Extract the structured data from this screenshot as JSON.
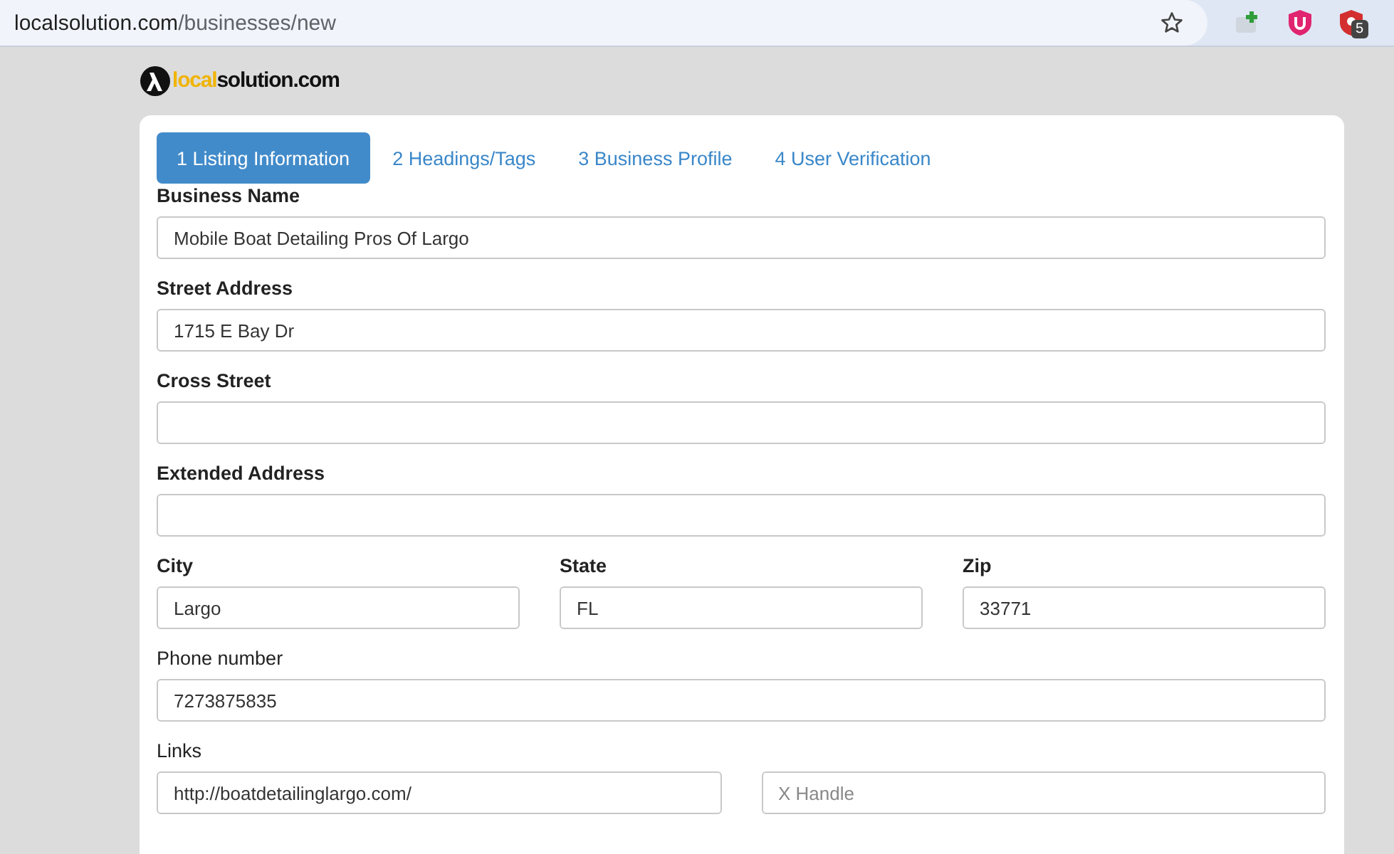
{
  "browser": {
    "url_host": "localsolution.com",
    "url_path": "/businesses/new",
    "extension_badge": "5"
  },
  "logo": {
    "accent": "local",
    "rest": "solution.com"
  },
  "tabs": [
    {
      "label": "1 Listing Information",
      "selected": true
    },
    {
      "label": "2 Headings/Tags",
      "selected": false
    },
    {
      "label": "3 Business Profile",
      "selected": false
    },
    {
      "label": "4 User Verification",
      "selected": false
    }
  ],
  "rows": [
    {
      "columns": [
        {
          "label": "Business Name",
          "bold": true,
          "inputs": [
            {
              "kind": "text",
              "value": "Mobile Boat Detailing Pros Of Largo"
            }
          ]
        }
      ]
    },
    {
      "columns": [
        {
          "label": "Street Address",
          "bold": true,
          "inputs": [
            {
              "kind": "text",
              "value": "1715 E Bay Dr"
            }
          ]
        }
      ]
    },
    {
      "columns": [
        {
          "label": "Cross Street",
          "bold": true,
          "inputs": [
            {
              "kind": "text"
            }
          ]
        }
      ]
    },
    {
      "columns": [
        {
          "label": "Extended Address",
          "bold": true,
          "inputs": [
            {
              "kind": "text"
            }
          ]
        }
      ]
    },
    {
      "columns": [
        {
          "label": "City",
          "bold": true,
          "inputs": [
            {
              "kind": "text",
              "value": "Largo"
            }
          ]
        },
        {
          "label": "State",
          "bold": true,
          "inputs": [
            {
              "kind": "text",
              "value": "FL"
            }
          ]
        },
        {
          "label": "Zip",
          "bold": true,
          "inputs": [
            {
              "kind": "text",
              "value": "33771"
            }
          ]
        }
      ]
    },
    {
      "columns": [
        {
          "label": "Phone number",
          "bold": false,
          "inputs": [
            {
              "kind": "text",
              "value": "7273875835"
            }
          ]
        }
      ]
    },
    {
      "columns": [
        {
          "label": "Links",
          "bold": false,
          "inputs": [
            {
              "kind": "text",
              "value": "http://boatdetailinglargo.com/"
            },
            {
              "kind": "text",
              "placeholder": "X Handle"
            }
          ]
        }
      ]
    }
  ]
}
